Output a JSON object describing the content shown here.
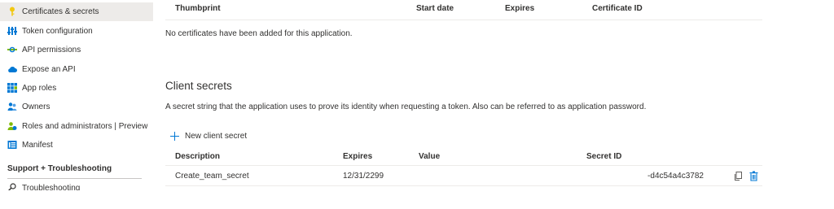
{
  "sidebar": {
    "items": [
      {
        "label": "Certificates & secrets",
        "icon": "key-icon",
        "active": true
      },
      {
        "label": "Token configuration",
        "icon": "token-config-icon"
      },
      {
        "label": "API permissions",
        "icon": "api-permissions-icon"
      },
      {
        "label": "Expose an API",
        "icon": "cloud-icon"
      },
      {
        "label": "App roles",
        "icon": "app-roles-icon"
      },
      {
        "label": "Owners",
        "icon": "owners-icon"
      },
      {
        "label": "Roles and administrators | Preview",
        "icon": "roles-admins-icon"
      },
      {
        "label": "Manifest",
        "icon": "manifest-icon"
      }
    ],
    "support_header": "Support + Troubleshooting",
    "support_items": [
      {
        "label": "Troubleshooting",
        "icon": "wrench-icon"
      }
    ]
  },
  "certificates": {
    "columns": [
      "Thumbprint",
      "Start date",
      "Expires",
      "Certificate ID"
    ],
    "empty_message": "No certificates have been added for this application."
  },
  "client_secrets": {
    "title": "Client secrets",
    "description": "A secret string that the application uses to prove its identity when requesting a token. Also can be referred to as application password.",
    "new_button_label": "New client secret",
    "columns": [
      "Description",
      "Expires",
      "Value",
      "Secret ID"
    ],
    "rows": [
      {
        "description": "Create_team_secret",
        "expires": "12/31/2299",
        "value": "",
        "secret_id": "-d4c54a4c3782"
      }
    ]
  },
  "colors": {
    "accent": "#0078d4",
    "active_bg": "#edebe9",
    "text": "#323130",
    "divider": "#edebe9"
  }
}
